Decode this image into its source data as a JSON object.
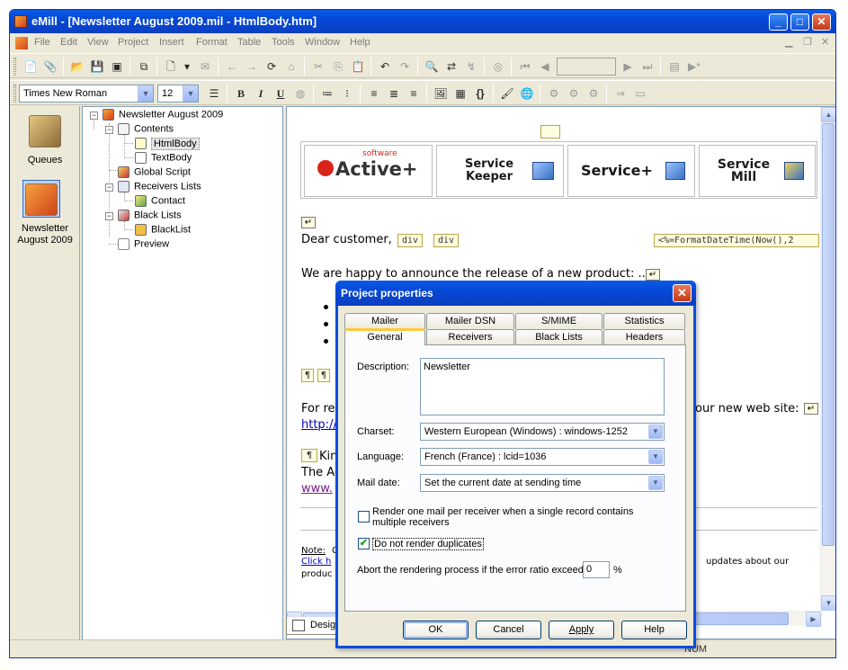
{
  "window": {
    "title": "eMill - [Newsletter August 2009.mil - HtmlBody.htm]"
  },
  "menu": [
    "File",
    "Edit",
    "View",
    "Project",
    "Insert",
    "Format",
    "Table",
    "Tools",
    "Window",
    "Help"
  ],
  "format_toolbar": {
    "font": "Times New Roman",
    "size": "12"
  },
  "left_pane": {
    "items": [
      "Queues",
      "Newsletter August 2009"
    ]
  },
  "tree": {
    "root": "Newsletter August 2009",
    "nodes": [
      "Contents",
      "HtmlBody",
      "TextBody",
      "Global Script",
      "Receivers Lists",
      "Contact",
      "Black Lists",
      "BlackList",
      "Preview"
    ]
  },
  "editor": {
    "logos": [
      "Active+",
      "Service Keeper",
      "Service+",
      "Service Mill"
    ],
    "logo_sub": "software",
    "greeting": "Dear customer,",
    "tag_div1": "div",
    "tag_div2": "div",
    "asp_tag": "<%=FormatDateTime(Now(),2",
    "announce": "We are happy to announce the release of a new product: ...",
    "for_text": "For re",
    "web_text": "our new web site:",
    "link_partial": "http://",
    "kin_text": "Kin",
    "the_text": "The Ac",
    "www_text": "www.",
    "note_label": "Note:",
    "note_c": "C",
    "click_text": "Click h",
    "product_text": "produc",
    "updates_text": "updates about our",
    "design_tab": "Design",
    "status_right": "NUM"
  },
  "dialog": {
    "title": "Project properties",
    "tabs_back": [
      "Mailer",
      "Mailer DSN",
      "S/MIME",
      "Statistics"
    ],
    "tabs_front": [
      "General",
      "Receivers",
      "Black Lists",
      "Headers"
    ],
    "active_tab": "General",
    "description_label": "Description:",
    "description_value": "Newsletter",
    "charset_label": "Charset:",
    "charset_value": "Western European (Windows) : windows-1252",
    "language_label": "Language:",
    "language_value": "French (France) : lcid=1036",
    "maildate_label": "Mail date:",
    "maildate_value": "Set the current date at sending time",
    "render_one_label": "Render one mail per receiver when a single record contains multiple receivers",
    "render_one_checked": false,
    "no_duplicates_label": "Do not render duplicates",
    "no_duplicates_checked": true,
    "abort_label": "Abort the rendering process if the error ratio exceeds",
    "abort_value": "0",
    "abort_unit": "%",
    "buttons": {
      "ok": "OK",
      "cancel": "Cancel",
      "apply": "Apply",
      "help": "Help"
    }
  }
}
